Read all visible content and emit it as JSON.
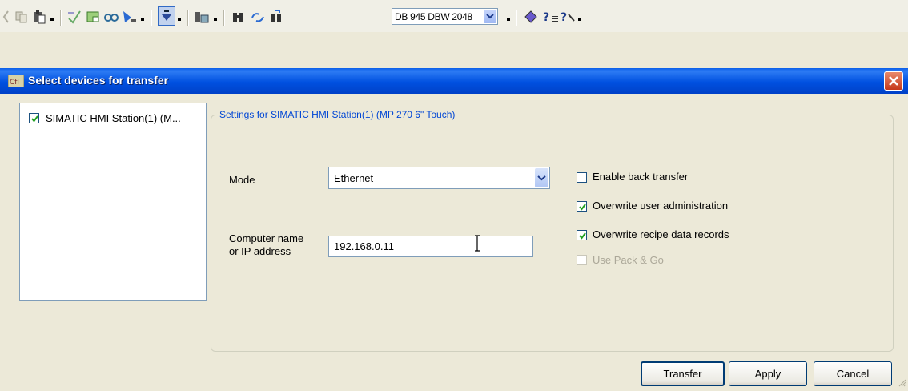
{
  "toolbar": {
    "icons": [
      "cut-icon",
      "copy-icon",
      "paste-icon",
      "check-icon",
      "compile-icon",
      "connect-icon",
      "download-icon",
      "insert-icon",
      "transfer-icon",
      "find-icon",
      "replace-icon",
      "goto-icon",
      "help-book-icon",
      "help-icon",
      "context-help-icon"
    ],
    "combo_value": "DB 945 DBW 2048"
  },
  "dialog": {
    "title": "Select devices for transfer",
    "device_label": "SIMATIC HMI Station(1) (M...",
    "device_checked": true,
    "group_title": "Settings for SIMATIC HMI Station(1) (MP 270 6\" Touch)",
    "mode_label": "Mode",
    "mode_value": "Ethernet",
    "address_label_line1": "Computer name",
    "address_label_line2": "or IP address",
    "address_value": "192.168.0.11",
    "options": [
      {
        "label": "Enable back transfer",
        "checked": false,
        "enabled": true
      },
      {
        "label": "Overwrite user administration",
        "checked": true,
        "enabled": true
      },
      {
        "label": "Overwrite recipe data records",
        "checked": true,
        "enabled": true
      },
      {
        "label": "Use Pack & Go",
        "checked": false,
        "enabled": false
      }
    ],
    "buttons": {
      "transfer": "Transfer",
      "apply": "Apply",
      "cancel": "Cancel"
    }
  },
  "colors": {
    "titlebar": "#0050e0",
    "legend_text": "#0046d5",
    "checkmark": "#21a121",
    "disabled_text": "#aca899"
  }
}
